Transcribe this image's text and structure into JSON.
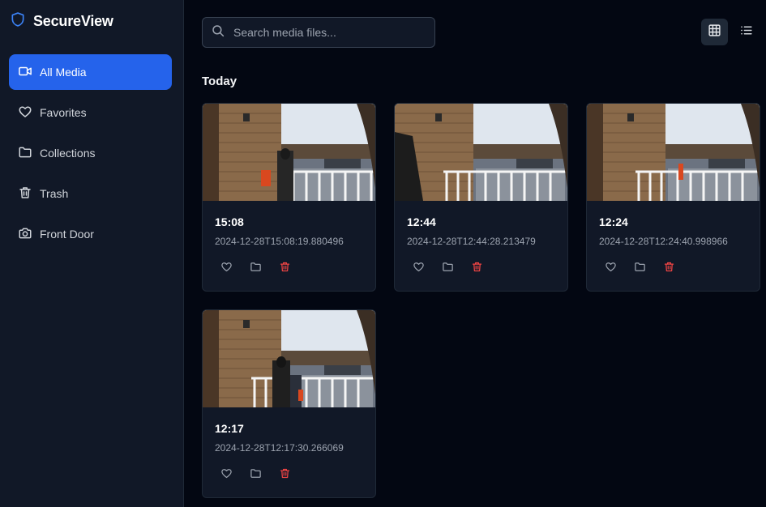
{
  "app": {
    "title": "SecureView"
  },
  "sidebar": {
    "items": [
      {
        "label": "All Media",
        "icon": "video-icon",
        "active": true
      },
      {
        "label": "Favorites",
        "icon": "heart-icon",
        "active": false
      },
      {
        "label": "Collections",
        "icon": "folder-icon",
        "active": false
      },
      {
        "label": "Trash",
        "icon": "trash-icon",
        "active": false
      },
      {
        "label": "Front Door",
        "icon": "camera-icon",
        "active": false
      }
    ]
  },
  "search": {
    "placeholder": "Search media files...",
    "value": ""
  },
  "view_toggle": {
    "active": "grid",
    "options": [
      "grid-icon",
      "list-icon"
    ]
  },
  "section": {
    "title": "Today"
  },
  "media": [
    {
      "time": "15:08",
      "timestamp": "2024-12-28T15:08:19.880496"
    },
    {
      "time": "12:44",
      "timestamp": "2024-12-28T12:44:28.213479"
    },
    {
      "time": "12:24",
      "timestamp": "2024-12-28T12:24:40.998966"
    },
    {
      "time": "12:17",
      "timestamp": "2024-12-28T12:17:30.266069"
    }
  ],
  "colors": {
    "background": "#030712",
    "sidebar": "#111827",
    "accent": "#2563eb",
    "danger": "#ef4444"
  }
}
